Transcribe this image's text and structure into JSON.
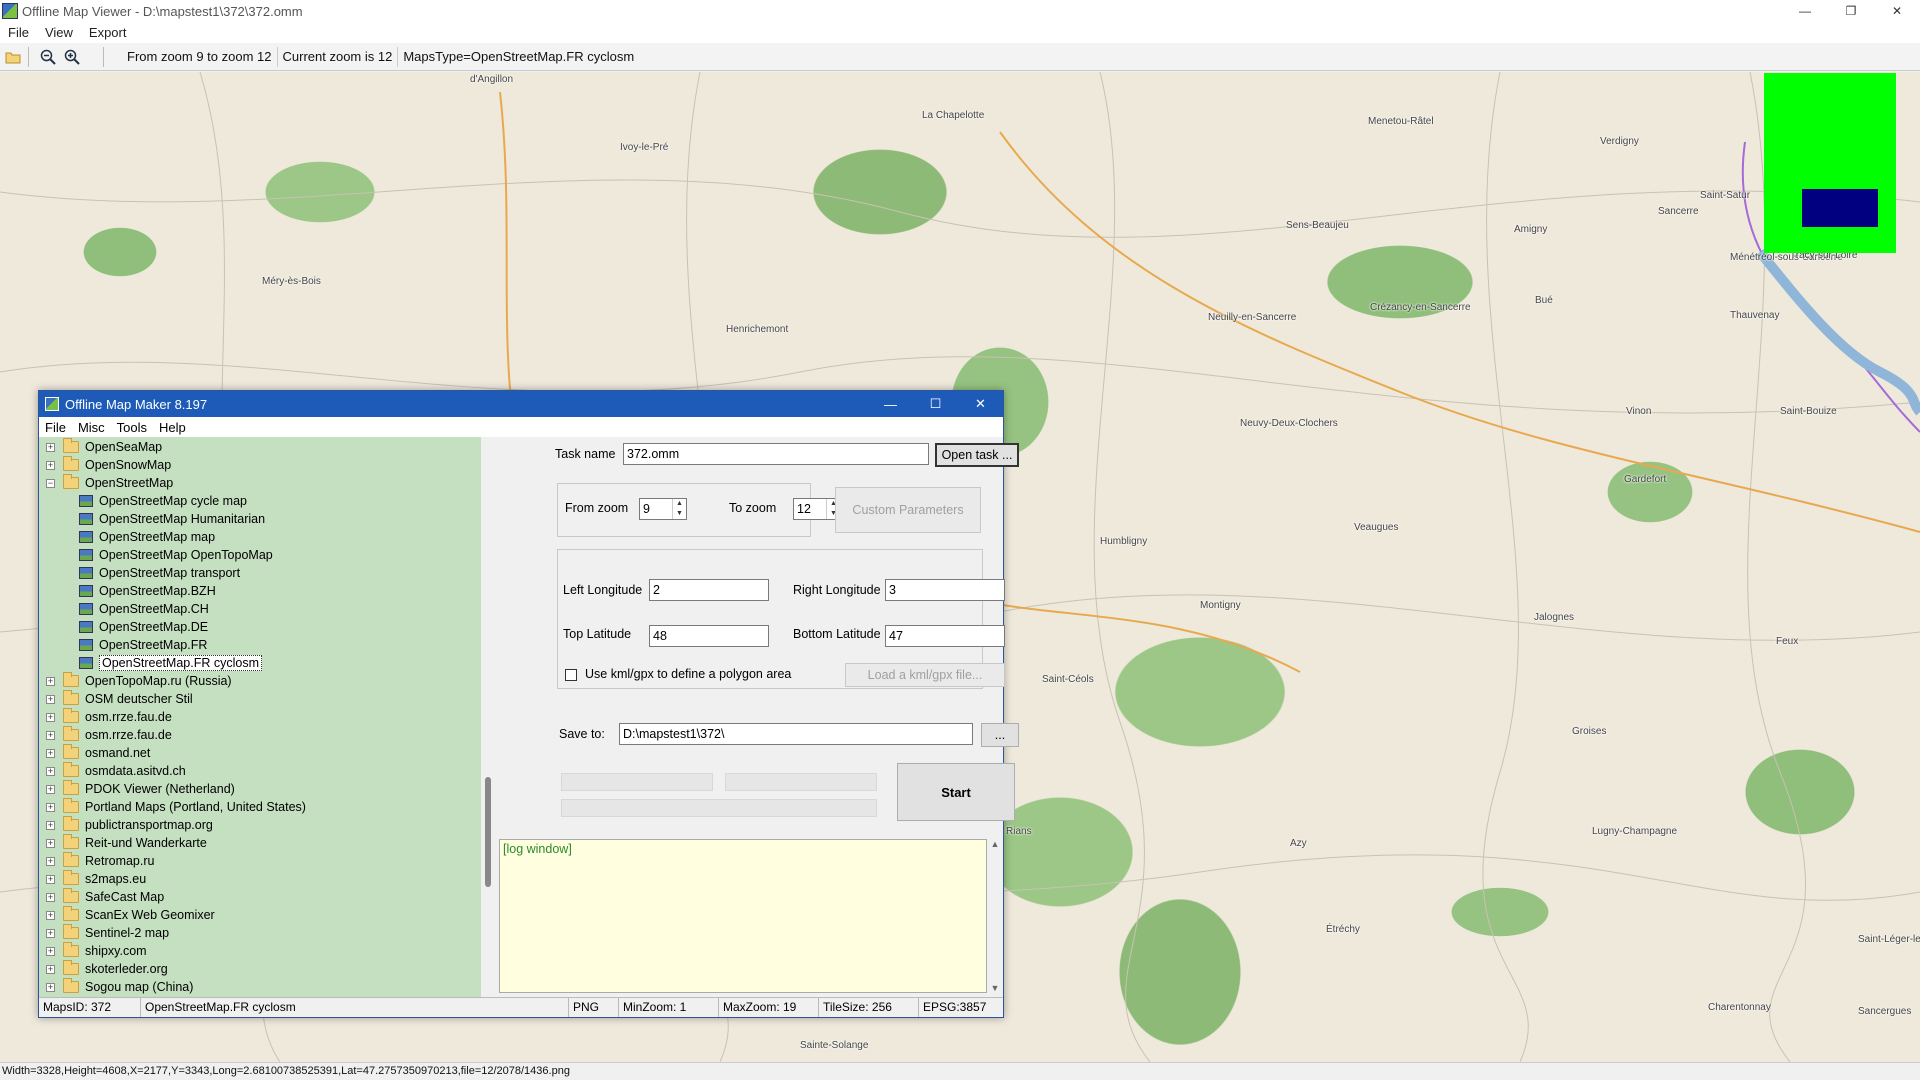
{
  "window": {
    "title": "Offline Map Viewer - D:\\mapstest1\\372\\372.omm",
    "controls": [
      "—",
      "❐",
      "✕"
    ]
  },
  "menubar": [
    "File",
    "View",
    "Export"
  ],
  "toolbar": {
    "zoom_range": "From zoom 9 to zoom 12",
    "current_zoom": "Current zoom is 12",
    "maps_type": "MapsType=OpenStreetMap.FR cyclosm"
  },
  "map": {
    "places": [
      "d'Angillon",
      "La Chapelotte",
      "Menetou-Râtel",
      "Verdigny",
      "Ivoy-le-Pré",
      "Saint-Satur",
      "Sancerre",
      "Amigny",
      "Sens-Beaujeu",
      "Ménétréol-sous-Sancerre",
      "Tracy-sur-Loire",
      "Méry-ès-Bois",
      "Henrichemont",
      "Neuilly-en-Sancerre",
      "Crézancy-en-Sancerre",
      "Bué",
      "Thauvenay",
      "Neuvy-Deux-Clochers",
      "Vinon",
      "Saint-Bouize",
      "Gardefort",
      "Humbligny",
      "Veaugues",
      "Montigny",
      "Jalognes",
      "Feux",
      "Saint-Céols",
      "Groises",
      "Lugny-Champagne",
      "Azy",
      "Rians",
      "Étréchy",
      "Charentonnay",
      "Sainte-Solange",
      "Saint-Léger-le-Petit",
      "Sancergues"
    ],
    "overview_colors": {
      "background": "#00ff00",
      "extent": "#000080"
    }
  },
  "dialog": {
    "title": "Offline Map Maker 8.197",
    "controls": [
      "—",
      "☐",
      "✕"
    ],
    "menu": [
      "File",
      "Misc",
      "Tools",
      "Help"
    ],
    "tree": [
      {
        "label": "OpenSeaMap",
        "level": 0,
        "exp": "+",
        "type": "folder"
      },
      {
        "label": "OpenSnowMap",
        "level": 0,
        "exp": "+",
        "type": "folder"
      },
      {
        "label": "OpenStreetMap",
        "level": 0,
        "exp": "−",
        "type": "folder"
      },
      {
        "label": "OpenStreetMap cycle map",
        "level": 1,
        "type": "map"
      },
      {
        "label": "OpenStreetMap Humanitarian",
        "level": 1,
        "type": "map"
      },
      {
        "label": "OpenStreetMap map",
        "level": 1,
        "type": "map"
      },
      {
        "label": "OpenStreetMap OpenTopoMap",
        "level": 1,
        "type": "map"
      },
      {
        "label": "OpenStreetMap transport",
        "level": 1,
        "type": "map"
      },
      {
        "label": "OpenStreetMap.BZH",
        "level": 1,
        "type": "map"
      },
      {
        "label": "OpenStreetMap.CH",
        "level": 1,
        "type": "map"
      },
      {
        "label": "OpenStreetMap.DE",
        "level": 1,
        "type": "map"
      },
      {
        "label": "OpenStreetMap.FR",
        "level": 1,
        "type": "map"
      },
      {
        "label": "OpenStreetMap.FR cyclosm",
        "level": 1,
        "type": "map",
        "selected": true
      },
      {
        "label": "OpenTopoMap.ru (Russia)",
        "level": 0,
        "exp": "+",
        "type": "folder"
      },
      {
        "label": "OSM deutscher Stil",
        "level": 0,
        "exp": "+",
        "type": "folder"
      },
      {
        "label": "osm.rrze.fau.de",
        "level": 0,
        "exp": "+",
        "type": "folder"
      },
      {
        "label": "osm.rrze.fau.de",
        "level": 0,
        "exp": "+",
        "type": "folder"
      },
      {
        "label": "osmand.net",
        "level": 0,
        "exp": "+",
        "type": "folder"
      },
      {
        "label": "osmdata.asitvd.ch",
        "level": 0,
        "exp": "+",
        "type": "folder"
      },
      {
        "label": "PDOK Viewer (Netherland)",
        "level": 0,
        "exp": "+",
        "type": "folder"
      },
      {
        "label": "Portland Maps (Portland, United States)",
        "level": 0,
        "exp": "+",
        "type": "folder"
      },
      {
        "label": "publictransportmap.org",
        "level": 0,
        "exp": "+",
        "type": "folder"
      },
      {
        "label": "Reit-und Wanderkarte",
        "level": 0,
        "exp": "+",
        "type": "folder"
      },
      {
        "label": "Retromap.ru",
        "level": 0,
        "exp": "+",
        "type": "folder"
      },
      {
        "label": "s2maps.eu",
        "level": 0,
        "exp": "+",
        "type": "folder"
      },
      {
        "label": "SafeCast Map",
        "level": 0,
        "exp": "+",
        "type": "folder"
      },
      {
        "label": "ScanEx Web Geomixer",
        "level": 0,
        "exp": "+",
        "type": "folder"
      },
      {
        "label": "Sentinel-2 map",
        "level": 0,
        "exp": "+",
        "type": "folder"
      },
      {
        "label": "shipxy.com",
        "level": 0,
        "exp": "+",
        "type": "folder"
      },
      {
        "label": "skoterleder.org",
        "level": 0,
        "exp": "+",
        "type": "folder"
      },
      {
        "label": "Sogou map (China)",
        "level": 0,
        "exp": "+",
        "type": "folder"
      }
    ],
    "form": {
      "task_name_label": "Task name",
      "task_name_value": "372.omm",
      "open_task_btn": "Open task ...",
      "from_zoom_label": "From zoom",
      "from_zoom_value": "9",
      "to_zoom_label": "To zoom",
      "to_zoom_value": "12",
      "custom_params_btn": "Custom Parameters",
      "left_lon_label": "Left Longitude",
      "left_lon_value": "2",
      "right_lon_label": "Right Longitude",
      "right_lon_value": "3",
      "top_lat_label": "Top Latitude",
      "top_lat_value": "48",
      "bottom_lat_label": "Bottom Latitude",
      "bottom_lat_value": "47",
      "kml_check_label": "Use kml/gpx to define a polygon area",
      "load_kml_btn": "Load a kml/gpx file...",
      "save_to_label": "Save to:",
      "save_to_value": "D:\\mapstest1\\372\\",
      "browse_btn": "...",
      "start_btn": "Start",
      "log_text": "[log window]"
    },
    "status": [
      "MapsID: 372",
      "OpenStreetMap.FR cyclosm",
      "PNG",
      "MinZoom: 1",
      "MaxZoom: 19",
      "TileSize: 256",
      "EPSG:3857"
    ]
  },
  "statusbar": "Width=3328,Height=4608,X=2177,Y=3343,Long=2.68100738525391,Lat=47.2757350970213,file=12/2078/1436.png"
}
